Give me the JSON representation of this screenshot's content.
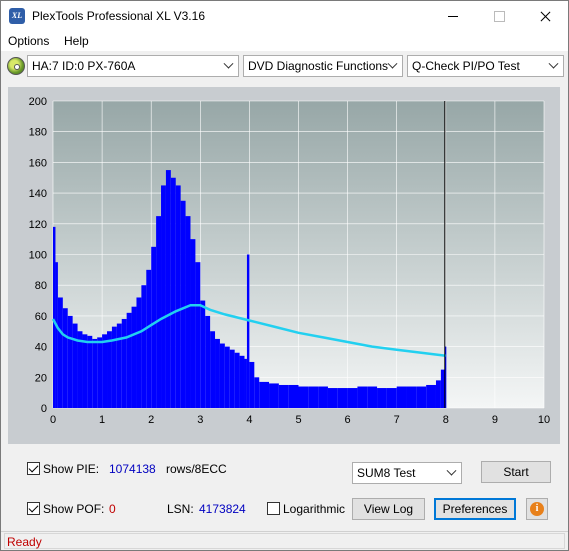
{
  "window": {
    "title": "PlexTools Professional XL V3.16",
    "icon_text": "XL"
  },
  "menu": {
    "options": "Options",
    "help": "Help"
  },
  "toolbar": {
    "drive": "HA:7 ID:0  PX-760A",
    "function": "DVD Diagnostic Functions",
    "test": "Q-Check PI/PO Test"
  },
  "chart_data": {
    "type": "bar",
    "title": "",
    "xlabel": "",
    "ylabel": "",
    "xlim": [
      0,
      10
    ],
    "ylim": [
      0,
      200
    ],
    "x_ticks": [
      "0",
      "1",
      "2",
      "3",
      "4",
      "5",
      "6",
      "7",
      "8",
      "9",
      "10"
    ],
    "y_ticks": [
      "0",
      "20",
      "40",
      "60",
      "80",
      "100",
      "120",
      "140",
      "160",
      "180",
      "200"
    ],
    "end_marker_x": 7.98,
    "colors": {
      "bars": "#0000ff",
      "line": "#22d0f0",
      "plot_bg_top": "#97a7a7",
      "plot_bg_bottom": "#f4f6f6"
    },
    "series": [
      {
        "kind": "bars",
        "x": [
          0.0,
          0.05,
          0.1,
          0.2,
          0.3,
          0.4,
          0.5,
          0.6,
          0.7,
          0.8,
          0.9,
          1.0,
          1.1,
          1.2,
          1.3,
          1.4,
          1.5,
          1.6,
          1.7,
          1.8,
          1.9,
          2.0,
          2.1,
          2.2,
          2.3,
          2.4,
          2.5,
          2.6,
          2.7,
          2.8,
          2.9,
          3.0,
          3.1,
          3.2,
          3.3,
          3.4,
          3.5,
          3.6,
          3.7,
          3.8,
          3.9,
          3.95,
          4.0,
          4.1,
          4.2,
          4.4,
          4.6,
          4.8,
          5.0,
          5.2,
          5.4,
          5.6,
          5.8,
          6.0,
          6.2,
          6.4,
          6.6,
          6.8,
          7.0,
          7.2,
          7.4,
          7.6,
          7.8,
          7.9,
          7.98
        ],
        "values": [
          118,
          95,
          72,
          65,
          60,
          55,
          50,
          48,
          47,
          45,
          46,
          48,
          50,
          53,
          55,
          58,
          62,
          66,
          72,
          80,
          90,
          105,
          125,
          145,
          155,
          150,
          145,
          135,
          125,
          110,
          95,
          70,
          60,
          50,
          45,
          42,
          40,
          38,
          36,
          34,
          32,
          100,
          30,
          20,
          17,
          16,
          15,
          15,
          14,
          14,
          14,
          13,
          13,
          13,
          14,
          14,
          13,
          13,
          14,
          14,
          14,
          15,
          18,
          25,
          40
        ]
      },
      {
        "kind": "line",
        "x": [
          0.0,
          0.1,
          0.2,
          0.3,
          0.5,
          0.7,
          0.9,
          1.0,
          1.2,
          1.5,
          1.8,
          2.0,
          2.2,
          2.5,
          2.8,
          3.0,
          3.2,
          3.5,
          4.0,
          4.5,
          5.0,
          5.5,
          6.0,
          6.5,
          7.0,
          7.5,
          8.0
        ],
        "values": [
          58,
          52,
          48,
          46,
          44,
          43,
          43,
          43,
          44,
          46,
          50,
          54,
          58,
          63,
          67,
          67,
          64,
          61,
          57,
          53,
          49,
          46,
          43,
          40,
          38,
          36,
          34
        ]
      }
    ]
  },
  "bottom": {
    "show_pie_label": "Show PIE:",
    "pie_value": "1074138",
    "rows_label": "rows/8ECC",
    "show_pof_label": "Show POF:",
    "pof_value": "0",
    "lsn_label": "LSN:",
    "lsn_value": "4173824",
    "log_label": "Logarithmic",
    "sum_select": "SUM8 Test",
    "start_label": "Start",
    "viewlog_label": "View Log",
    "prefs_label": "Preferences",
    "info_glyph": "i"
  },
  "status": {
    "text": "Ready"
  }
}
